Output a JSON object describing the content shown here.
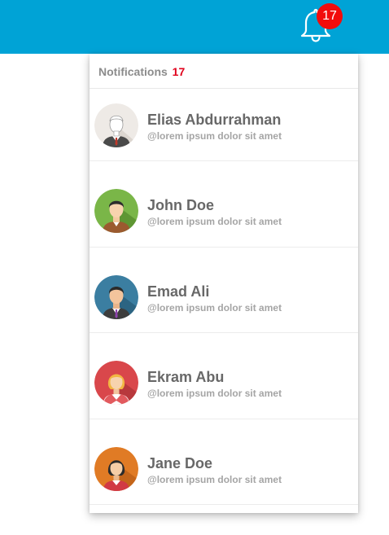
{
  "topbar": {
    "bar_color": "#00a3d6",
    "bell_icon": "bell-icon",
    "badge_count": "17"
  },
  "notifications": {
    "title": "Notifications",
    "count": "17",
    "items": [
      {
        "name": "Elias Abdurrahman",
        "subtitle": "@lorem ipsum dolor sit amet",
        "avatar": "man-avatar-sketch"
      },
      {
        "name": "John Doe",
        "subtitle": "@lorem ipsum dolor sit amet",
        "avatar": "man-avatar-green"
      },
      {
        "name": "Emad Ali",
        "subtitle": "@lorem ipsum dolor sit amet",
        "avatar": "man-avatar-blue"
      },
      {
        "name": "Ekram Abu",
        "subtitle": "@lorem ipsum dolor sit amet",
        "avatar": "woman-avatar-red"
      },
      {
        "name": "Jane Doe",
        "subtitle": "@lorem ipsum dolor sit amet",
        "avatar": "woman-avatar-orange"
      }
    ]
  }
}
